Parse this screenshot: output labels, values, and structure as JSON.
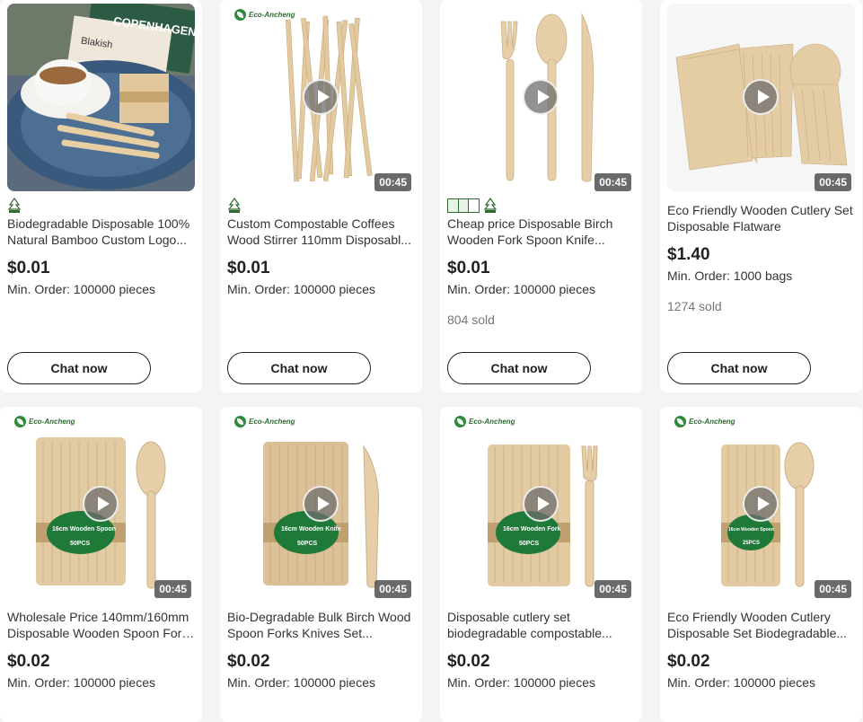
{
  "products": [
    {
      "title_line1": "Biodegradable Disposable 100%",
      "title_line2": "Natural Bamboo Custom Logo...",
      "price": "$0.01",
      "min_order": "Min. Order: 100000 pieces",
      "sold": "",
      "duration": "",
      "brand": "",
      "photo_text_1": "COPENHAGEN",
      "photo_text_2": "Blakish",
      "certs": [
        "fsc-icon"
      ],
      "chat_label": "Chat now"
    },
    {
      "title_line1": "Custom Compostable Coffees",
      "title_line2": "Wood Stirrer 110mm Disposabl...",
      "price": "$0.01",
      "min_order": "Min. Order: 100000 pieces",
      "sold": "",
      "duration": "00:45",
      "brand": "Eco-Ancheng",
      "certs": [
        "fsc-icon"
      ],
      "chat_label": "Chat now"
    },
    {
      "title_line1": "Cheap price Disposable Birch",
      "title_line2": "Wooden Fork Spoon Knife...",
      "price": "$0.01",
      "min_order": "Min. Order: 100000 pieces",
      "sold": "804 sold",
      "duration": "00:45",
      "brand": "",
      "certs": [
        "certification-badge-icon",
        "fsc-icon"
      ],
      "chat_label": "Chat now"
    },
    {
      "title_line1": "Eco Friendly Wooden Cutlery Set",
      "title_line2": "Disposable Flatware",
      "price": "$1.40",
      "min_order": "Min. Order: 1000 bags",
      "sold": "1274 sold",
      "duration": "00:45",
      "brand": "",
      "certs": [],
      "chat_label": "Chat now"
    },
    {
      "title_line1": "Wholesale Price 140mm/160mm",
      "title_line2": "Disposable Wooden Spoon Fork...",
      "price": "$0.02",
      "min_order": "Min. Order: 100000 pieces",
      "sold": "",
      "duration": "00:45",
      "brand": "Eco-Ancheng",
      "package_label": "16cm Wooden Spoon",
      "package_count": "50PCS",
      "certs": [],
      "chat_label": "Chat now"
    },
    {
      "title_line1": "Bio-Degradable Bulk Birch Wood",
      "title_line2": "Spoon Forks Knives Set...",
      "price": "$0.02",
      "min_order": "Min. Order: 100000 pieces",
      "sold": "",
      "duration": "00:45",
      "brand": "Eco-Ancheng",
      "package_label": "16cm Wooden Knife",
      "package_count": "50PCS",
      "certs": [],
      "chat_label": "Chat now"
    },
    {
      "title_line1": "Disposable cutlery set",
      "title_line2": "biodegradable compostable...",
      "price": "$0.02",
      "min_order": "Min. Order: 100000 pieces",
      "sold": "",
      "duration": "00:45",
      "brand": "Eco-Ancheng",
      "package_label": "16cm Wooden Fork",
      "package_count": "50PCS",
      "certs": [],
      "chat_label": "Chat now"
    },
    {
      "title_line1": "Eco Friendly Wooden Cutlery",
      "title_line2": "Disposable Set Biodegradable...",
      "price": "$0.02",
      "min_order": "Min. Order: 100000 pieces",
      "sold": "",
      "duration": "00:45",
      "brand": "Eco-Ancheng",
      "package_label": "16cm Wooden Spoon",
      "package_count": "25PCS",
      "certs": [],
      "chat_label": "Chat now"
    }
  ],
  "colors": {
    "wood": "#dcc49c",
    "wood_dark": "#c9ad80",
    "brand_green": "#2f8a3a",
    "duration_bg": "#505050"
  }
}
